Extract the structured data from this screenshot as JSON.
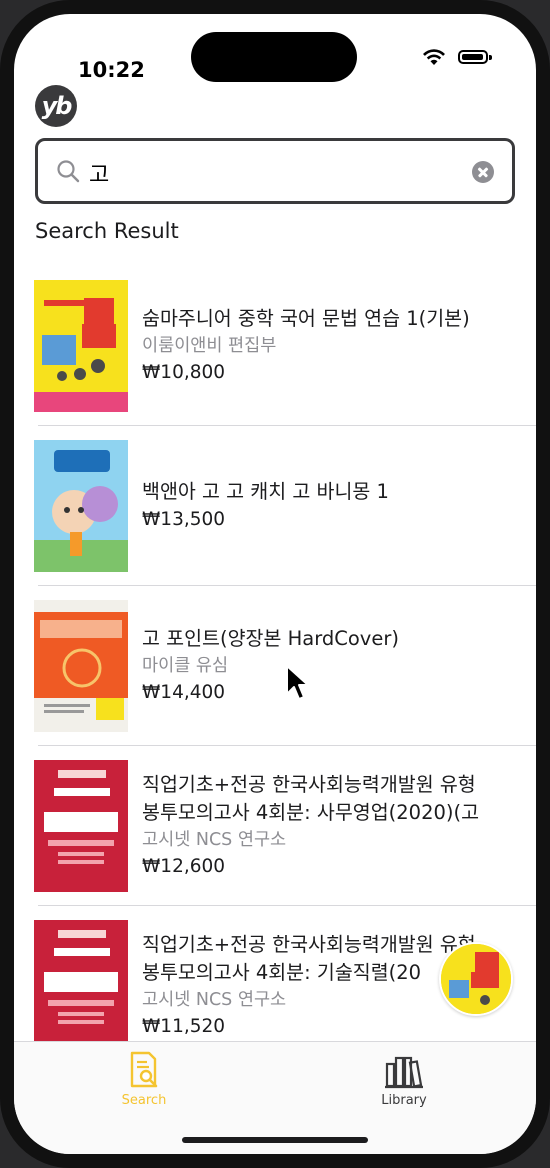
{
  "status_bar": {
    "time": "10:22"
  },
  "app": {
    "logo_text": "yb"
  },
  "search": {
    "value": "고",
    "placeholder": ""
  },
  "results": {
    "section_title": "Search Result",
    "items": [
      {
        "title": "숨마주니어 중학 국어 문법 연습 1(기본)",
        "author": "이룸이앤비 편집부",
        "price": "₩10,800"
      },
      {
        "title": "백앤아 고 고 캐치 고 바니몽 1",
        "author": "",
        "price": "₩13,500"
      },
      {
        "title": "고 포인트(양장본 HardCover)",
        "author": "마이클 유심",
        "price": "₩14,400"
      },
      {
        "title": "직업기초+전공 한국사회능력개발원 유형 봉투모의고사 4회분: 사무영업(2020)(고",
        "title_line1": "직업기초+전공 한국사회능력개발원 유형",
        "title_line2": "봉투모의고사 4회분: 사무영업(2020)(고",
        "author": "고시넷 NCS 연구소",
        "price": "₩12,600"
      },
      {
        "title": "직업기초+전공 한국사회능력개발원 유형 봉투모의고사 4회분: 기술직렬(20",
        "title_line1": "직업기초+전공 한국사회능력개발원 유형",
        "title_line2": "봉투모의고사 4회분: 기술직렬(20",
        "author": "고시넷 NCS 연구소",
        "price": "₩11,520"
      }
    ]
  },
  "tabs": [
    {
      "label": "Search",
      "icon": "search-book-icon",
      "active": true
    },
    {
      "label": "Library",
      "icon": "library-icon",
      "active": false
    }
  ],
  "colors": {
    "accent": "#f4c430",
    "text": "#1c1c1e",
    "secondary": "#8e8e93"
  }
}
